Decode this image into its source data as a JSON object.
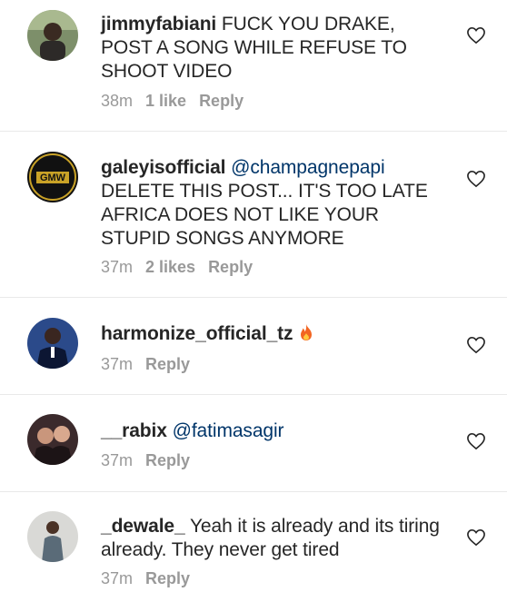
{
  "comments": [
    {
      "username": "jimmyfabiani",
      "mention": "",
      "text": "FUCK YOU DRAKE,  POST A SONG WHILE REFUSE TO SHOOT VIDEO",
      "time": "38m",
      "likes": "1 like",
      "reply": "Reply"
    },
    {
      "username": "galeyisofficial",
      "mention": "@champagnepapi",
      "text": "DELETE THIS POST... IT'S TOO LATE AFRICA DOES NOT LIKE YOUR STUPID SONGS ANYMORE",
      "time": "37m",
      "likes": "2 likes",
      "reply": "Reply",
      "avatar_text": "GMW"
    },
    {
      "username": "harmonize_official_tz",
      "mention": "",
      "text": "",
      "emoji": "fire-emoji",
      "time": "37m",
      "likes": "",
      "reply": "Reply"
    },
    {
      "username": "__rabix",
      "mention": "@fatimasagir",
      "text": "",
      "time": "37m",
      "likes": "",
      "reply": "Reply"
    },
    {
      "username": "_dewale_",
      "mention": "",
      "text": "Yeah it is already and its tiring already.  They never get tired",
      "time": "37m",
      "likes": "",
      "reply": "Reply"
    }
  ],
  "icons": {
    "like": "heart-outline-icon",
    "emoji": "fire-emoji"
  },
  "colors": {
    "text": "#262626",
    "mention": "#003569",
    "meta": "#999999",
    "divider": "#e9e9e9"
  }
}
